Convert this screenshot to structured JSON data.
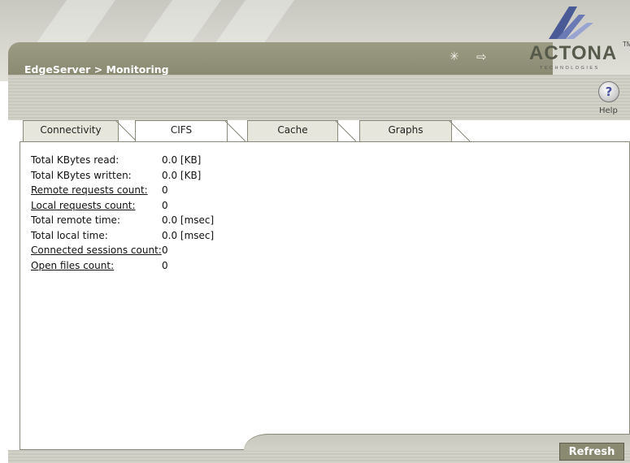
{
  "header": {
    "breadcrumb": "EdgeServer > Monitoring",
    "icons": [
      "wand-icon",
      "logout-icon"
    ]
  },
  "logo": {
    "word": "ACTONA",
    "tm": "TM",
    "sub": "TECHNOLOGIES"
  },
  "help": {
    "glyph": "?",
    "label": "Help"
  },
  "tabs": [
    {
      "label": "Connectivity",
      "active": false
    },
    {
      "label": "CIFS",
      "active": true
    },
    {
      "label": "Cache",
      "active": false
    },
    {
      "label": "Graphs",
      "active": false
    }
  ],
  "stats": [
    {
      "label": "Total KBytes read:",
      "value": "0.0 [KB]",
      "link": false
    },
    {
      "label": "Total KBytes written:",
      "value": "0.0 [KB]",
      "link": false
    },
    {
      "label": "Remote requests count:",
      "value": "0",
      "link": true
    },
    {
      "label": "Local requests count:",
      "value": "0",
      "link": true
    },
    {
      "label": "Total remote time:",
      "value": "0.0 [msec]",
      "link": false
    },
    {
      "label": "Total local time:",
      "value": "0.0 [msec]",
      "link": false
    },
    {
      "label": "Connected sessions count:",
      "value": "0",
      "link": true
    },
    {
      "label": "Open files count:",
      "value": "0",
      "link": true
    }
  ],
  "footer": {
    "refresh_label": "Refresh"
  },
  "colors": {
    "bar": "#8a8a72",
    "accent_text": "#ffffff",
    "panel_border": "#8a8a7a"
  }
}
